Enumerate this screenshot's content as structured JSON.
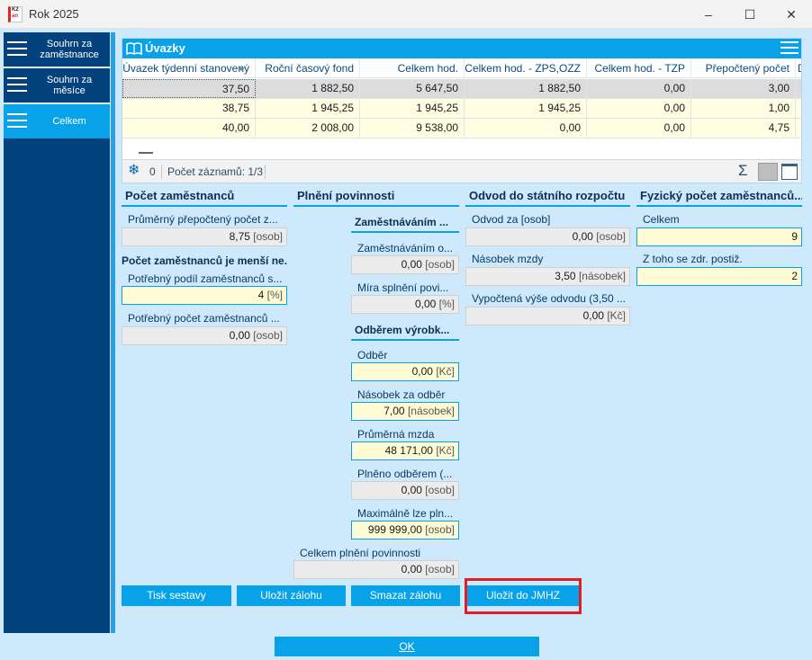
{
  "window": {
    "title": "Rok 2025",
    "icon_text": [
      "K2",
      "an"
    ],
    "controls": {
      "minimize": "–",
      "maximize": "☐",
      "close": "✕"
    }
  },
  "sidebar": {
    "items": [
      {
        "label": "Souhrn za zaměstnance"
      },
      {
        "label": "Souhrn za měsíce"
      },
      {
        "label": "Celkem"
      }
    ]
  },
  "grid": {
    "title": "Úvazky",
    "columns": [
      "Úvazek týdenní stanovený",
      "Roční časový fond",
      "Celkem hod.",
      "Celkem hod. - ZPS,OZZ",
      "Celkem hod. - TZP",
      "Přepočtený počet",
      "D"
    ],
    "rows": [
      [
        "37,50",
        "1 882,50",
        "5 647,50",
        "1 882,50",
        "0,00",
        "3,00"
      ],
      [
        "38,75",
        "1 945,25",
        "1 945,25",
        "1 945,25",
        "0,00",
        "1,00"
      ],
      [
        "40,00",
        "2 008,00",
        "9 538,00",
        "0,00",
        "0,00",
        "4,75"
      ]
    ],
    "footer": {
      "zero": "0",
      "count": "Počet záznamů: 1/3",
      "sigma": "Σ"
    }
  },
  "pocet": {
    "title": "Počet zaměstnanců",
    "prumerny_label": "Průměrný přepočtený počet z...",
    "prumerny_value": "8,75",
    "prumerny_unit": "[osob]",
    "mensi_label": "Počet zaměstnanců je menší ne...",
    "podil_label": "Potřebný podíl zaměstnanců s...",
    "podil_value": "4",
    "podil_unit": "[%]",
    "potrebny_label": "Potřebný počet zaměstnanců ...",
    "potrebny_value": "0,00",
    "potrebny_unit": "[osob]"
  },
  "plneni": {
    "title": "Plnění povinnosti",
    "zam_title": "Zaměstnáváním ...",
    "zam_o_label": "Zaměstnáváním o...",
    "zam_o_value": "0,00",
    "zam_o_unit": "[osob]",
    "mira_label": "Míra splnění povi...",
    "mira_value": "0,00",
    "mira_unit": "[%]",
    "odber_title": "Odběrem výrobk...",
    "odber_label": "Odběr",
    "odber_value": "0,00",
    "odber_unit": "[Kč]",
    "nasobek_label": "Násobek za odběr",
    "nasobek_value": "7,00",
    "nasobek_unit": "[násobek]",
    "mzda_label": "Průměrná mzda",
    "mzda_value": "48 171,00",
    "mzda_unit": "[Kč]",
    "plneno_label": "Plněno odběrem (...",
    "plneno_value": "0,00",
    "plneno_unit": "[osob]",
    "max_label": "Maximálně lze pln...",
    "max_value": "999 999,00",
    "max_unit": "[osob]",
    "celkem_label": "Celkem plnění povinnosti",
    "celkem_value": "0,00",
    "celkem_unit": "[osob]"
  },
  "odvod": {
    "title": "Odvod do státního rozpočtu",
    "za_label": "Odvod za [osob]",
    "za_value": "0,00",
    "za_unit": "[osob]",
    "nasobek_label": "Násobek mzdy",
    "nasobek_value": "3,50",
    "nasobek_unit": "[násobek]",
    "vypoctena_label": "Vypočtená výše odvodu (3,50 ...",
    "vypoctena_value": "0,00",
    "vypoctena_unit": "[Kč]"
  },
  "fyzicky": {
    "title": "Fyzický počet zaměstnanců...",
    "celkem_label": "Celkem",
    "celkem_value": "9",
    "zdr_label": "Z toho se zdr. postiž.",
    "zdr_value": "2"
  },
  "buttons": {
    "tisk": "Tisk sestavy",
    "ulozit": "Uložit zálohu",
    "smazat": "Smazat zálohu",
    "jmhz": "Uložit do JMHZ",
    "ok": "OK"
  }
}
